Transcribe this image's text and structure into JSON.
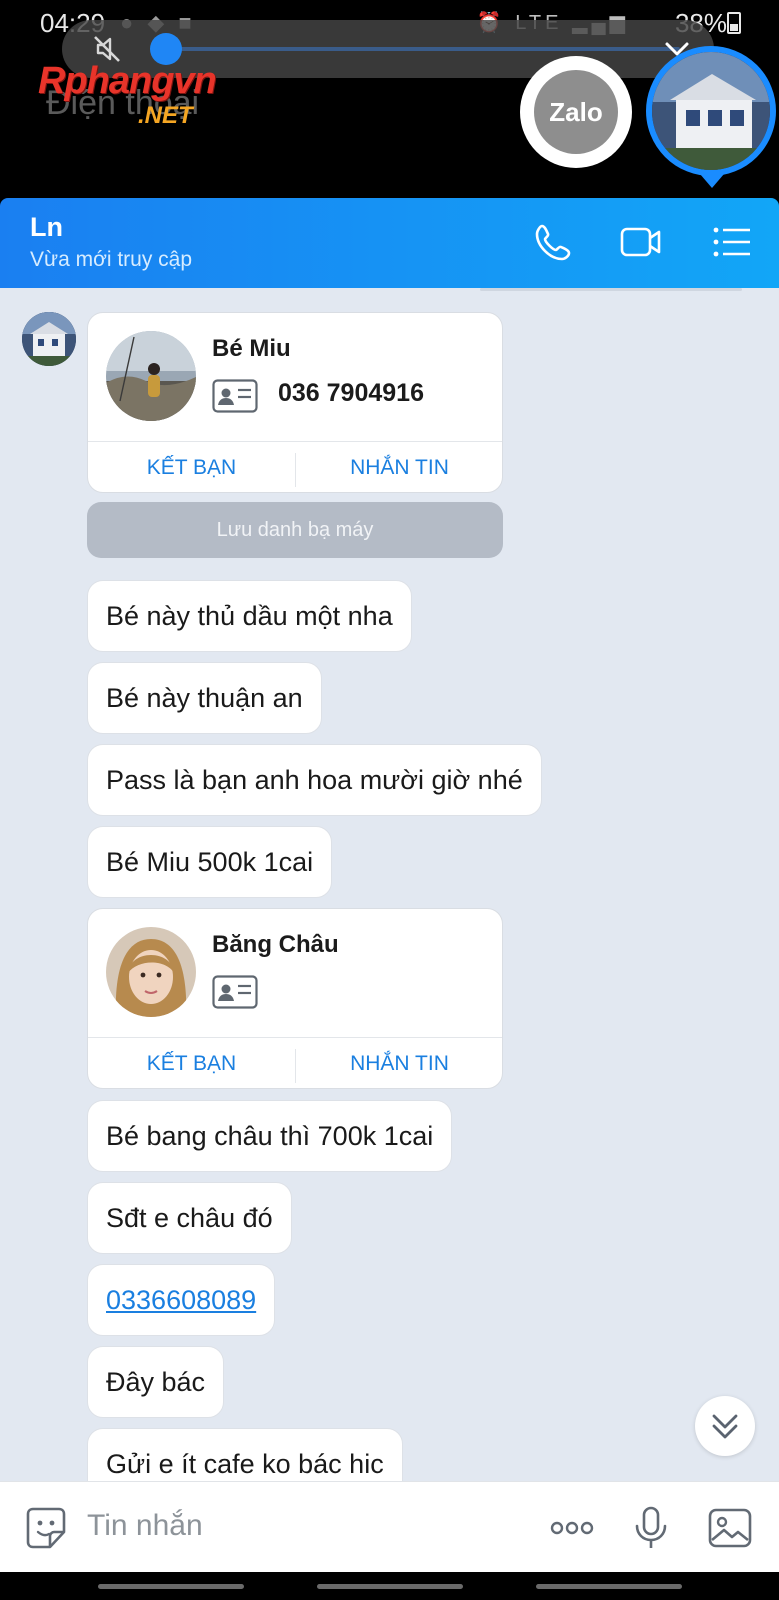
{
  "status_bar": {
    "time": "04:29",
    "network": "LTE",
    "battery": "38%"
  },
  "watermark": {
    "brand": "Rphangvn",
    "suffix": ".NET",
    "behind_text": "Điện thoại"
  },
  "floating": {
    "zalo_label": "Zalo"
  },
  "header": {
    "name": "Ln",
    "status": "Vừa mới truy cập"
  },
  "cards": [
    {
      "name": "Bé Miu",
      "phone": "036 7904916",
      "add_friend": "KẾT BẠN",
      "message": "NHẮN TIN"
    },
    {
      "name": "Băng Châu",
      "phone": "",
      "add_friend": "KẾT BẠN",
      "message": "NHẮN TIN"
    }
  ],
  "save_contact_label": "Lưu danh bạ máy",
  "messages": [
    "Bé này thủ dầu một nha",
    "Bé này thuận an",
    "Pass là bạn anh hoa mười giờ nhé",
    "Bé Miu 500k 1cai",
    "Bé bang châu thì 700k 1cai",
    "Sđt e châu đó",
    "0336608089",
    "Đây bác",
    "Gửi e ít cafe ko bác hic"
  ],
  "composer": {
    "placeholder": "Tin nhắn"
  },
  "colors": {
    "header_start": "#1a7ff1",
    "header_end": "#12a6f7",
    "chat_background": "#e2e8f1",
    "link": "#1a7fe0"
  },
  "media": {
    "seek_progress": 0.02
  }
}
